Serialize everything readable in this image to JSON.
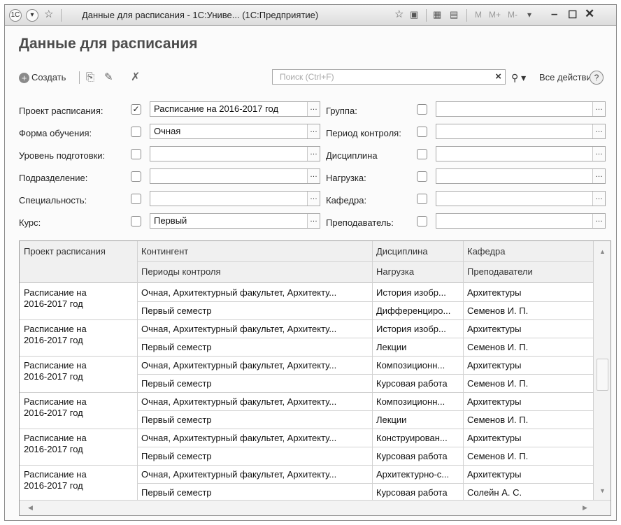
{
  "window": {
    "title": "Данные для расписания - 1С:Униве... (1С:Предприятие)",
    "memory_buttons": [
      "M",
      "M+",
      "M-"
    ]
  },
  "form": {
    "title": "Данные для расписания"
  },
  "toolbar": {
    "create_label": "Создать",
    "search_placeholder": "Поиск (Ctrl+F)",
    "all_actions_label": "Все действия",
    "help_label": "?"
  },
  "filters": {
    "left": [
      {
        "label": "Проект расписания:",
        "checked": true,
        "value": "Расписание на 2016-2017 год"
      },
      {
        "label": "Форма обучения:",
        "checked": false,
        "value": "Очная"
      },
      {
        "label": "Уровень подготовки:",
        "checked": false,
        "value": ""
      },
      {
        "label": "Подразделение:",
        "checked": false,
        "value": ""
      },
      {
        "label": "Специальность:",
        "checked": false,
        "value": ""
      },
      {
        "label": "Курс:",
        "checked": false,
        "value": "Первый"
      }
    ],
    "right": [
      {
        "label": "Группа:",
        "checked": false,
        "value": ""
      },
      {
        "label": "Период контроля:",
        "checked": false,
        "value": ""
      },
      {
        "label": "Дисциплина",
        "checked": false,
        "value": ""
      },
      {
        "label": "Нагрузка:",
        "checked": false,
        "value": ""
      },
      {
        "label": "Кафедра:",
        "checked": false,
        "value": ""
      },
      {
        "label": "Преподаватель:",
        "checked": false,
        "value": ""
      }
    ]
  },
  "table": {
    "headers": {
      "project": "Проект расписания",
      "contingent": "Контингент",
      "periods": "Периоды контроля",
      "discipline": "Дисциплина",
      "load": "Нагрузка",
      "department": "Кафедра",
      "teachers": "Преподаватели"
    },
    "rows": [
      {
        "project": [
          "Расписание на",
          "2016-2017 год"
        ],
        "contingent": "Очная, Архитектурный факультет, Архитекту...",
        "period": "Первый семестр",
        "discipline": "История изобр...",
        "load": "Дифференциро...",
        "department": "Архитектуры",
        "teacher": "Семенов И. П."
      },
      {
        "project": [
          "Расписание на",
          "2016-2017 год"
        ],
        "contingent": "Очная, Архитектурный факультет, Архитекту...",
        "period": "Первый семестр",
        "discipline": "История изобр...",
        "load": "Лекции",
        "department": "Архитектуры",
        "teacher": "Семенов И. П."
      },
      {
        "project": [
          "Расписание на",
          "2016-2017 год"
        ],
        "contingent": "Очная, Архитектурный факультет, Архитекту...",
        "period": "Первый семестр",
        "discipline": "Композиционн...",
        "load": "Курсовая работа",
        "department": "Архитектуры",
        "teacher": "Семенов И. П."
      },
      {
        "project": [
          "Расписание на",
          "2016-2017 год"
        ],
        "contingent": "Очная, Архитектурный факультет, Архитекту...",
        "period": "Первый семестр",
        "discipline": "Композиционн...",
        "load": "Лекции",
        "department": "Архитектуры",
        "teacher": "Семенов И. П."
      },
      {
        "project": [
          "Расписание на",
          "2016-2017 год"
        ],
        "contingent": "Очная, Архитектурный факультет, Архитекту...",
        "period": "Первый семестр",
        "discipline": "Конструирован...",
        "load": "Курсовая работа",
        "department": "Архитектуры",
        "teacher": "Семенов И. П."
      },
      {
        "project": [
          "Расписание на",
          "2016-2017 год"
        ],
        "contingent": "Очная, Архитектурный факультет, Архитекту...",
        "period": "Первый семестр",
        "discipline": "Архитектурно-с...",
        "load": "Курсовая работа",
        "department": "Архитектуры",
        "teacher": "Солейн А. С."
      }
    ]
  }
}
